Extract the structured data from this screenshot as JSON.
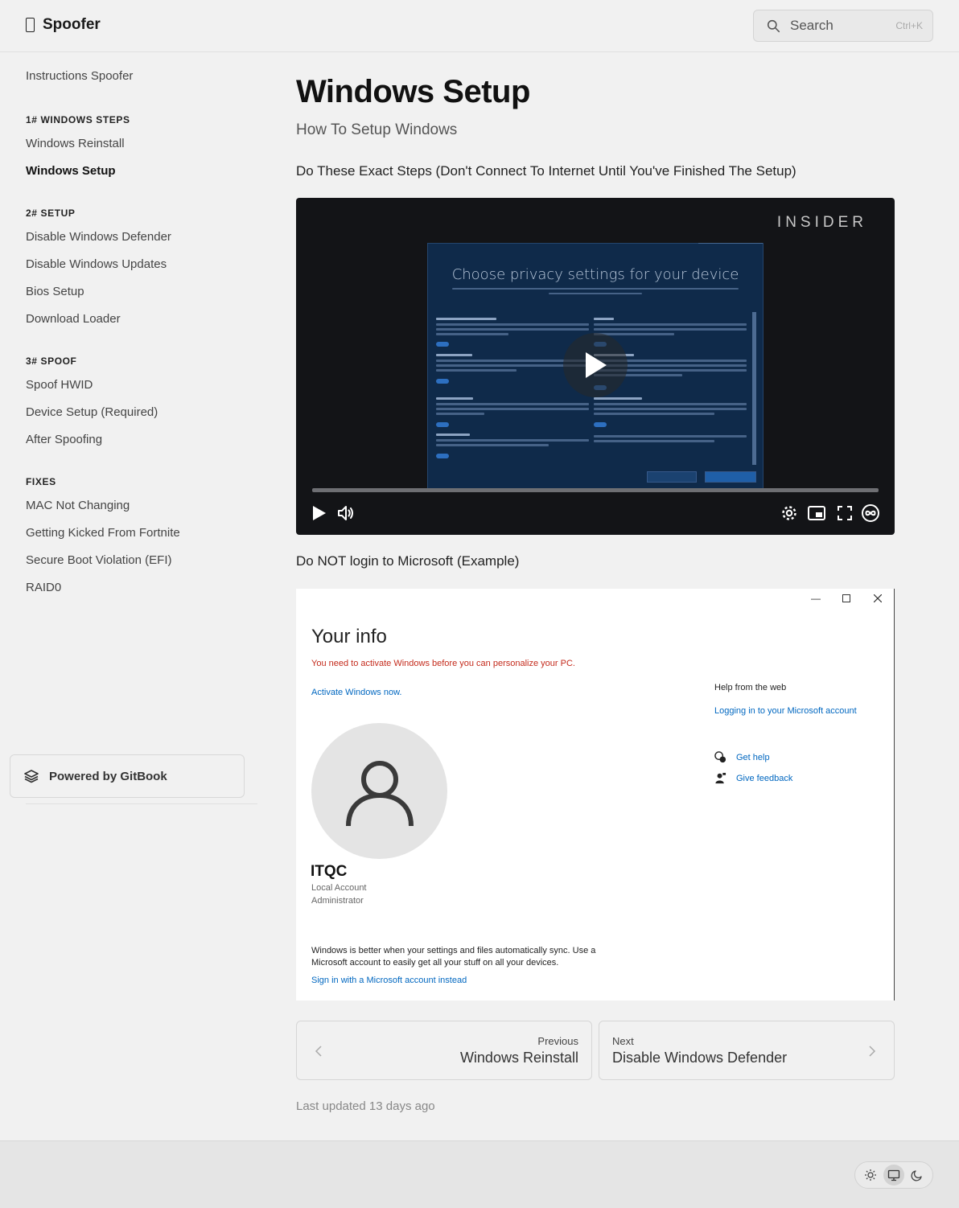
{
  "header": {
    "site_title": "Spoofer",
    "search_placeholder": "Search",
    "search_shortcut": "Ctrl+K"
  },
  "sidebar": {
    "top_item": "Instructions Spoofer",
    "sections": [
      {
        "heading": "1# WINDOWS STEPS",
        "items": [
          "Windows Reinstall",
          "Windows Setup"
        ]
      },
      {
        "heading": "2# SETUP",
        "items": [
          "Disable Windows Defender",
          "Disable Windows Updates",
          "Bios Setup",
          "Download Loader"
        ]
      },
      {
        "heading": "3# SPOOF",
        "items": [
          "Spoof HWID",
          "Device Setup (Required)",
          "After Spoofing"
        ]
      },
      {
        "heading": "FIXES",
        "items": [
          "MAC Not Changing",
          "Getting Kicked From Fortnite",
          "Secure Boot Violation (EFI)",
          "RAID0"
        ]
      }
    ],
    "active_item": "Windows Setup",
    "powered_by": "Powered by GitBook"
  },
  "page": {
    "title": "Windows Setup",
    "subtitle": "How To Setup Windows",
    "paragraph_1": "Do These Exact Steps (Don't Connect To Internet Until You've Finished The Setup)",
    "paragraph_2": "Do NOT login to Microsoft (Example)"
  },
  "video": {
    "watermark": "INSIDER",
    "screen_title": "Choose privacy settings for your device"
  },
  "screenshot": {
    "title": "Your info",
    "warning": "You need to activate Windows before you can personalize your PC.",
    "activate_link": "Activate Windows now.",
    "help_heading": "Help from the web",
    "help_link": "Logging in to your Microsoft account",
    "get_help": "Get help",
    "give_feedback": "Give feedback",
    "username": "ITQC",
    "account_type": "Local Account",
    "account_role": "Administrator",
    "sync_text": "Windows is better when your settings and files automatically sync. Use a Microsoft account to easily get all your stuff on all your devices.",
    "sign_in_link": "Sign in with a Microsoft account instead"
  },
  "pagination": {
    "previous_label": "Previous",
    "previous_title": "Windows Reinstall",
    "next_label": "Next",
    "next_title": "Disable Windows Defender"
  },
  "last_updated": "Last updated 13 days ago"
}
